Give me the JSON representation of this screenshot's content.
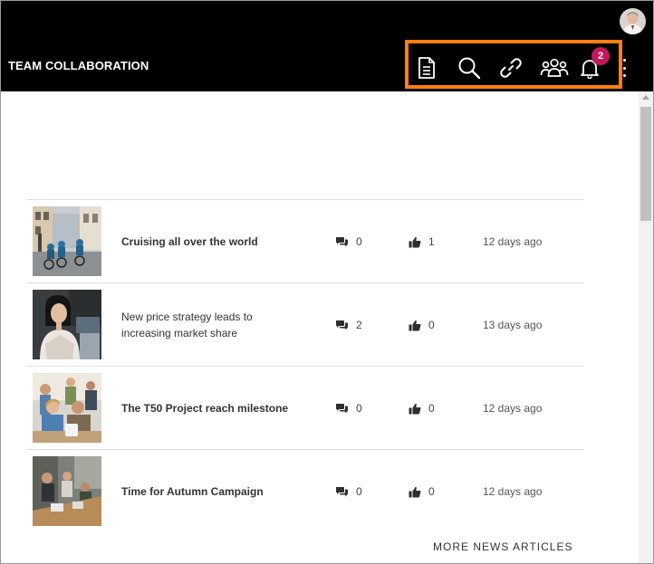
{
  "header": {
    "app_title": "TEAM COLLABORATION",
    "toolbar": [
      {
        "name": "document-icon"
      },
      {
        "name": "search-icon"
      },
      {
        "name": "link-icon"
      },
      {
        "name": "team-icon"
      },
      {
        "name": "bell-icon"
      }
    ],
    "notification_count": "2",
    "colors": {
      "header_bg": "#000000",
      "highlight": "#ff7f11",
      "badge": "#c2185b"
    }
  },
  "news": {
    "articles": [
      {
        "title": "Cruising all over the world",
        "comments": "0",
        "likes": "1",
        "date": "12 days ago"
      },
      {
        "title": "New price strategy leads to increasing market share",
        "comments": "2",
        "likes": "0",
        "date": "13 days ago"
      },
      {
        "title": "The T50 Project reach milestone",
        "comments": "0",
        "likes": "0",
        "date": "12 days ago"
      },
      {
        "title": "Time for Autumn Campaign",
        "comments": "0",
        "likes": "0",
        "date": "12 days ago"
      }
    ],
    "more_label": "MORE NEWS ARTICLES"
  }
}
